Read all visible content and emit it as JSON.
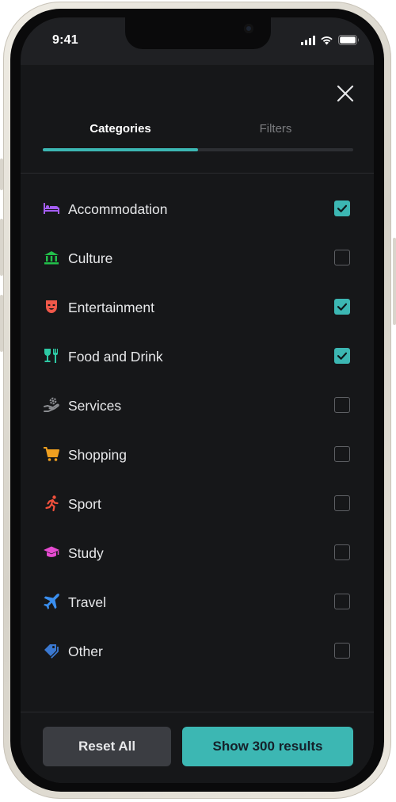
{
  "status_bar": {
    "time": "9:41"
  },
  "tabs": [
    {
      "label": "Categories",
      "active": true
    },
    {
      "label": "Filters",
      "active": false
    }
  ],
  "colors": {
    "accent": "#3cb7b3",
    "sheet_bg": "#161719",
    "checkbox_border": "#5e6064"
  },
  "categories": [
    {
      "label": "Accommodation",
      "icon": "bed-icon",
      "icon_color": "#a45df2",
      "checked": true
    },
    {
      "label": "Culture",
      "icon": "museum-icon",
      "icon_color": "#22c04a",
      "checked": false
    },
    {
      "label": "Entertainment",
      "icon": "theater-mask-icon",
      "icon_color": "#f0584a",
      "checked": true
    },
    {
      "label": "Food and Drink",
      "icon": "wine-fork-icon",
      "icon_color": "#2dc9a4",
      "checked": true
    },
    {
      "label": "Services",
      "icon": "hand-gear-icon",
      "icon_color": "#8a8c90",
      "checked": false
    },
    {
      "label": "Shopping",
      "icon": "cart-icon",
      "icon_color": "#f0a020",
      "checked": false
    },
    {
      "label": "Sport",
      "icon": "runner-icon",
      "icon_color": "#f0503c",
      "checked": false
    },
    {
      "label": "Study",
      "icon": "graduation-cap-icon",
      "icon_color": "#e64bd1",
      "checked": false
    },
    {
      "label": "Travel",
      "icon": "airplane-icon",
      "icon_color": "#3a8ff0",
      "checked": false
    },
    {
      "label": "Other",
      "icon": "tags-icon",
      "icon_color": "#3a78d0",
      "checked": false
    }
  ],
  "buttons": {
    "reset_label": "Reset All",
    "show_label": "Show 300 results"
  }
}
